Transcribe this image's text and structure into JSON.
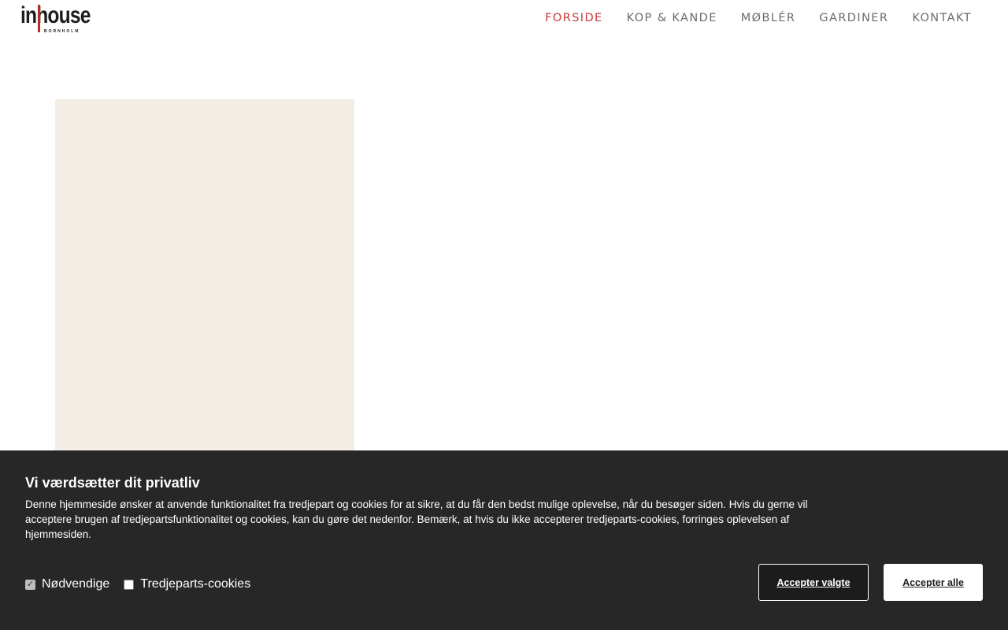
{
  "header": {
    "logo": {
      "word": "inhouse",
      "sub": "BORNHOLM"
    },
    "nav": [
      {
        "label": "FORSIDE",
        "active": true
      },
      {
        "label": "KOP & KANDE",
        "active": false
      },
      {
        "label": "MØBLÉR",
        "active": false
      },
      {
        "label": "GARDINER",
        "active": false
      },
      {
        "label": "KONTAKT",
        "active": false
      }
    ]
  },
  "colors": {
    "accent": "#c8373b",
    "nav_text": "#6b6b6b",
    "hero_block": "#f2ede5",
    "cookie_bg": "#272727"
  },
  "cookie": {
    "title": "Vi værdsætter dit privatliv",
    "text": "Denne hjemmeside ønsker at anvende funktionalitet fra tredjepart og cookies for at sikre, at du får den bedst mulige oplevelse, når du besøger siden. Hvis du gerne vil acceptere brugen af tredjepartsfunktionalitet og cookies, kan du gøre det nedenfor. Bemærk, at hvis du ikke accepterer tredjeparts-cookies, forringes oplevelsen af hjemmesiden.",
    "options": [
      {
        "label": "Nødvendige",
        "checked": true,
        "disabled": true
      },
      {
        "label": "Tredjeparts-cookies",
        "checked": false,
        "disabled": false
      }
    ],
    "accept_selected_label": "Accepter valgte",
    "accept_all_label": "Accepter alle"
  }
}
